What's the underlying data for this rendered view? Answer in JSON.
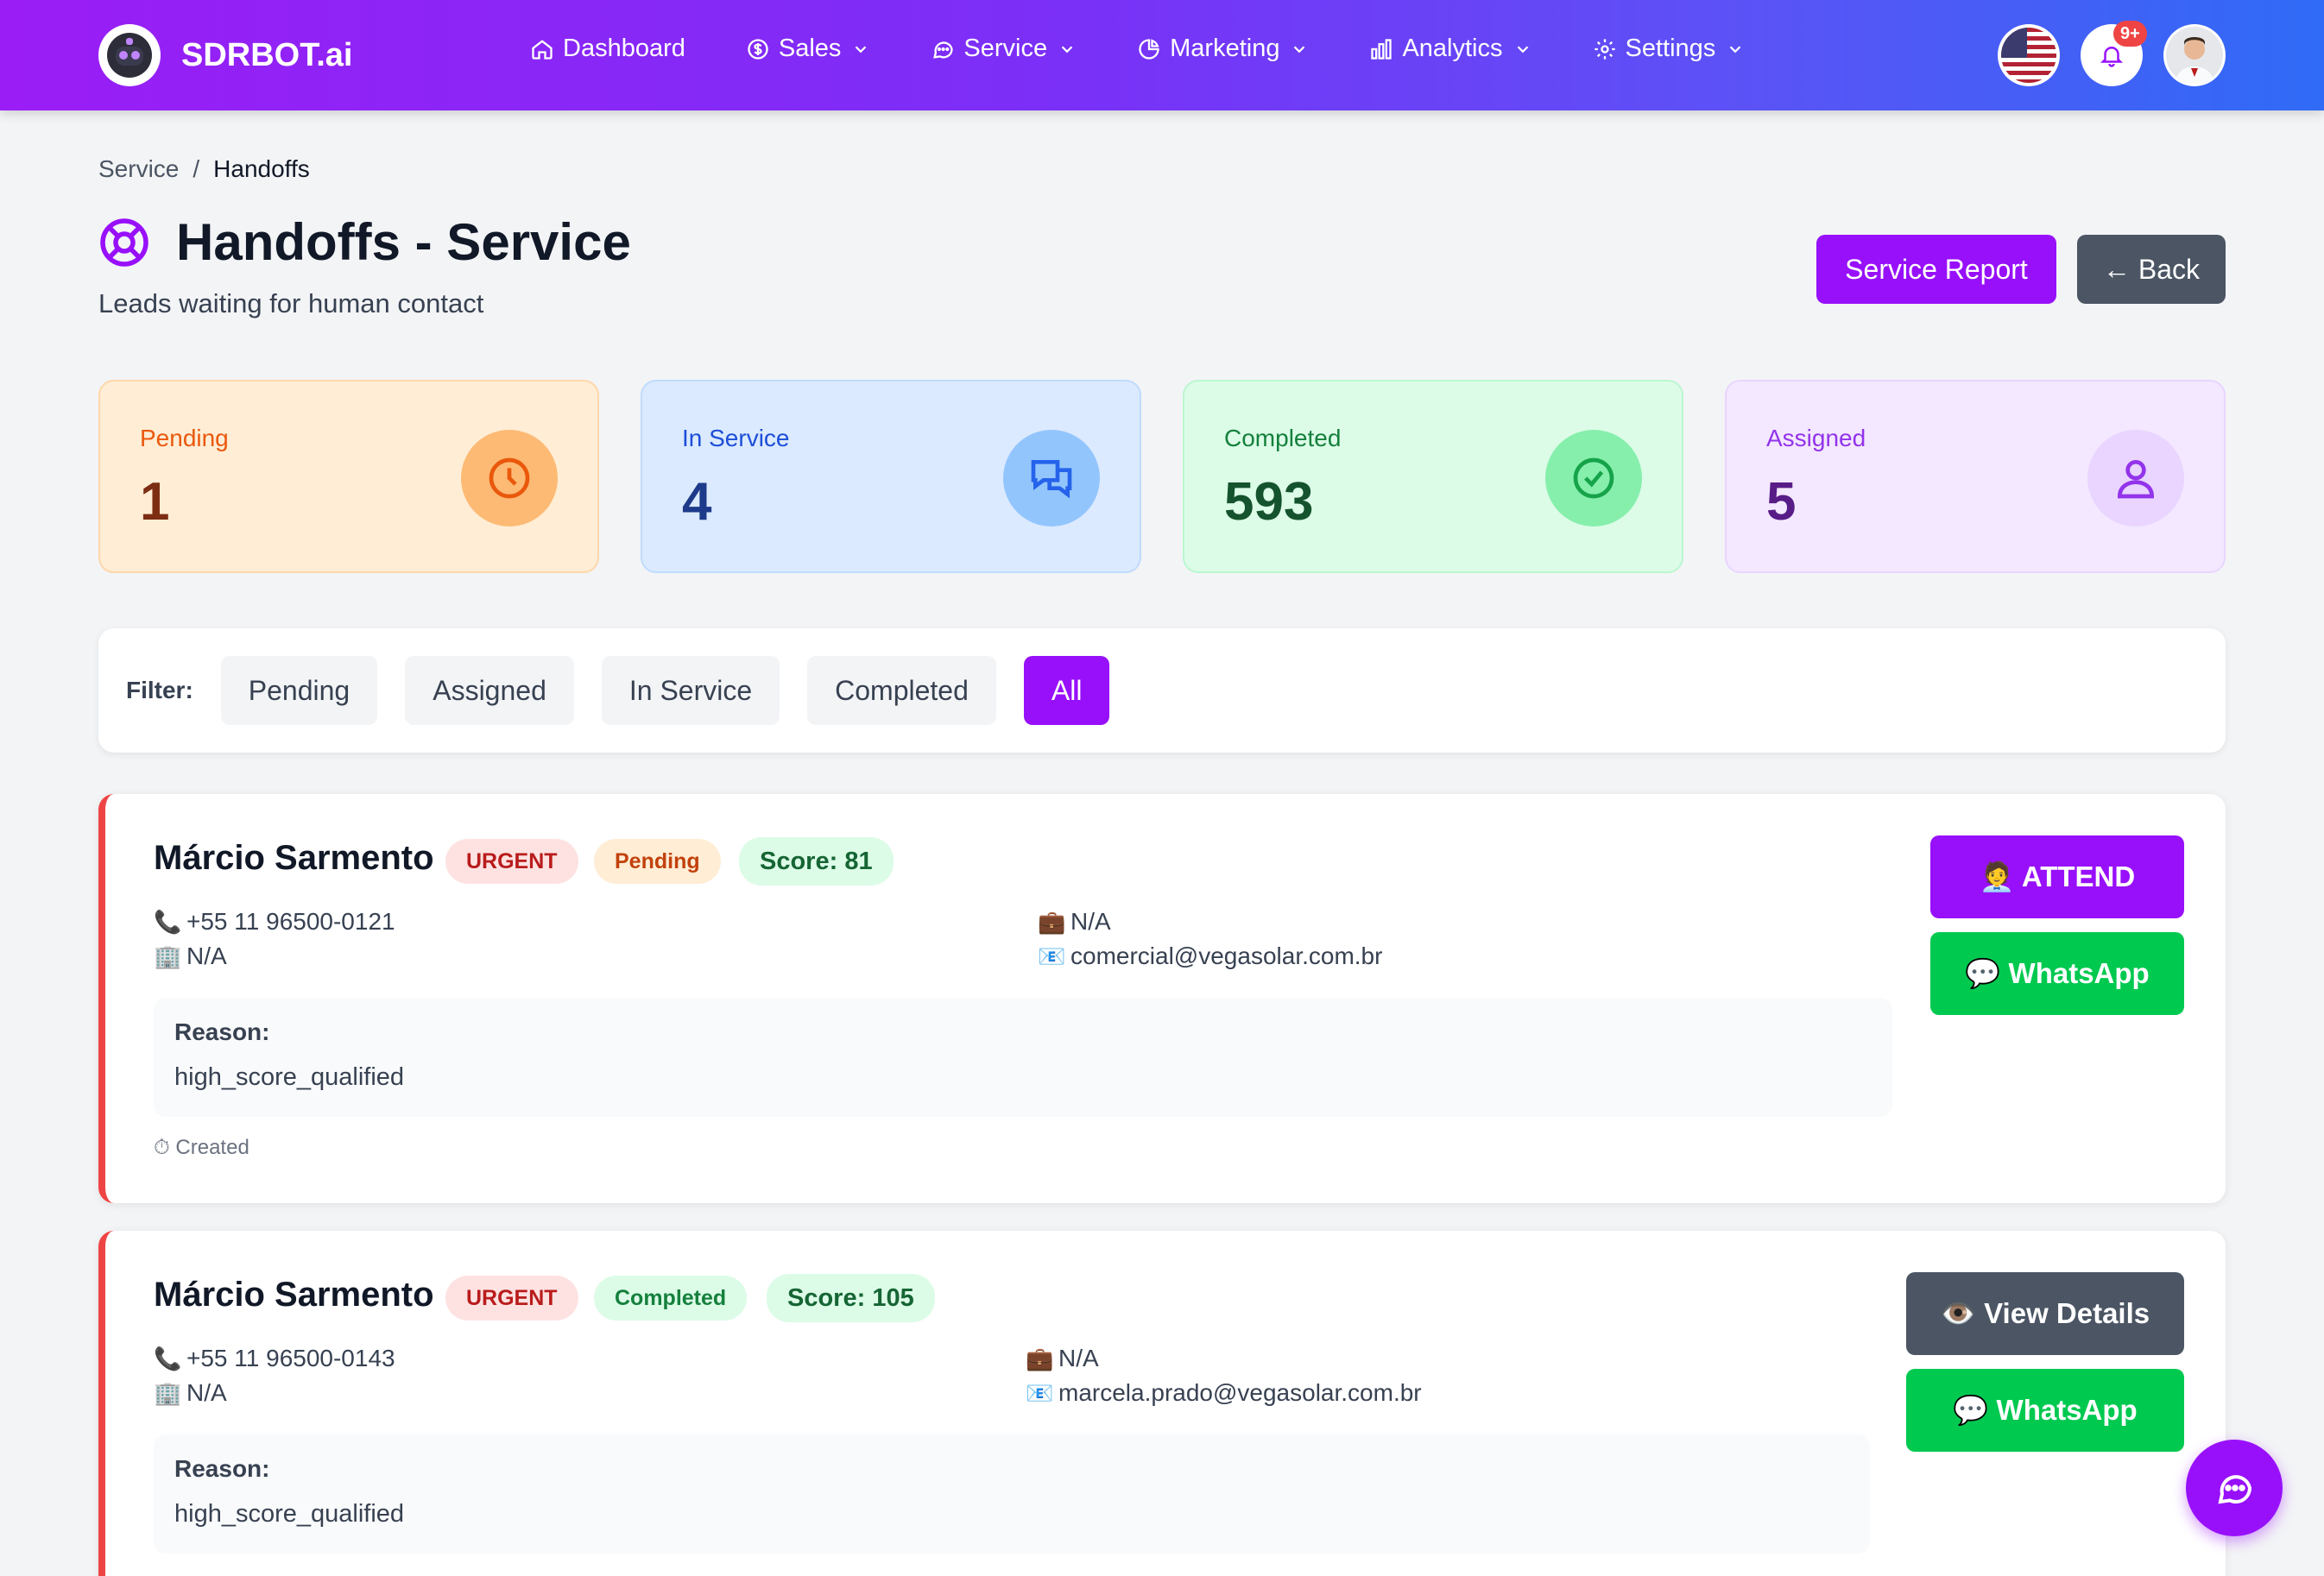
{
  "app": {
    "name": "SDRBOT.ai"
  },
  "nav": {
    "items": [
      {
        "label": "Dashboard",
        "icon": "home-icon",
        "dropdown": false
      },
      {
        "label": "Sales",
        "icon": "dollar-icon",
        "dropdown": true
      },
      {
        "label": "Service",
        "icon": "chat-icon",
        "dropdown": true
      },
      {
        "label": "Marketing",
        "icon": "pie-chart-icon",
        "dropdown": true
      },
      {
        "label": "Analytics",
        "icon": "bar-chart-icon",
        "dropdown": true
      },
      {
        "label": "Settings",
        "icon": "gear-icon",
        "dropdown": true
      }
    ],
    "notification_count": "9+"
  },
  "breadcrumb": {
    "parent": "Service",
    "separator": "/",
    "current": "Handoffs"
  },
  "header": {
    "title": "Handoffs - Service",
    "subtitle": "Leads waiting for human contact",
    "report_button": "Service Report",
    "back_button": "← Back"
  },
  "stats": [
    {
      "label": "Pending",
      "value": "1",
      "icon": "clock-icon",
      "color": "#ea580c"
    },
    {
      "label": "In Service",
      "value": "4",
      "icon": "chat-bubbles-icon",
      "color": "#2563eb"
    },
    {
      "label": "Completed",
      "value": "593",
      "icon": "check-circle-icon",
      "color": "#16a34a"
    },
    {
      "label": "Assigned",
      "value": "5",
      "icon": "user-icon",
      "color": "#9333ea"
    }
  ],
  "filter": {
    "label": "Filter:",
    "options": [
      "Pending",
      "Assigned",
      "In Service",
      "Completed",
      "All"
    ],
    "active": "All"
  },
  "handoffs": [
    {
      "name": "Márcio Sarmento",
      "priority": "URGENT",
      "status": "Pending",
      "score": "Score: 81",
      "phone": "+55 11 96500-0121",
      "company": "N/A",
      "job": "N/A",
      "email": "comercial@vegasolar.com.br",
      "reason_label": "Reason:",
      "reason": "high_score_qualified",
      "created": "Created",
      "primary_action": "🧑‍💼 ATTEND",
      "secondary_action": "💬 WhatsApp"
    },
    {
      "name": "Márcio Sarmento",
      "priority": "URGENT",
      "status": "Completed",
      "score": "Score: 105",
      "phone": "+55 11 96500-0143",
      "company": "N/A",
      "job": "N/A",
      "email": "marcela.prado@vegasolar.com.br",
      "reason_label": "Reason:",
      "reason": "high_score_qualified",
      "primary_action": "👁️ View Details",
      "secondary_action": "💬 WhatsApp"
    }
  ]
}
